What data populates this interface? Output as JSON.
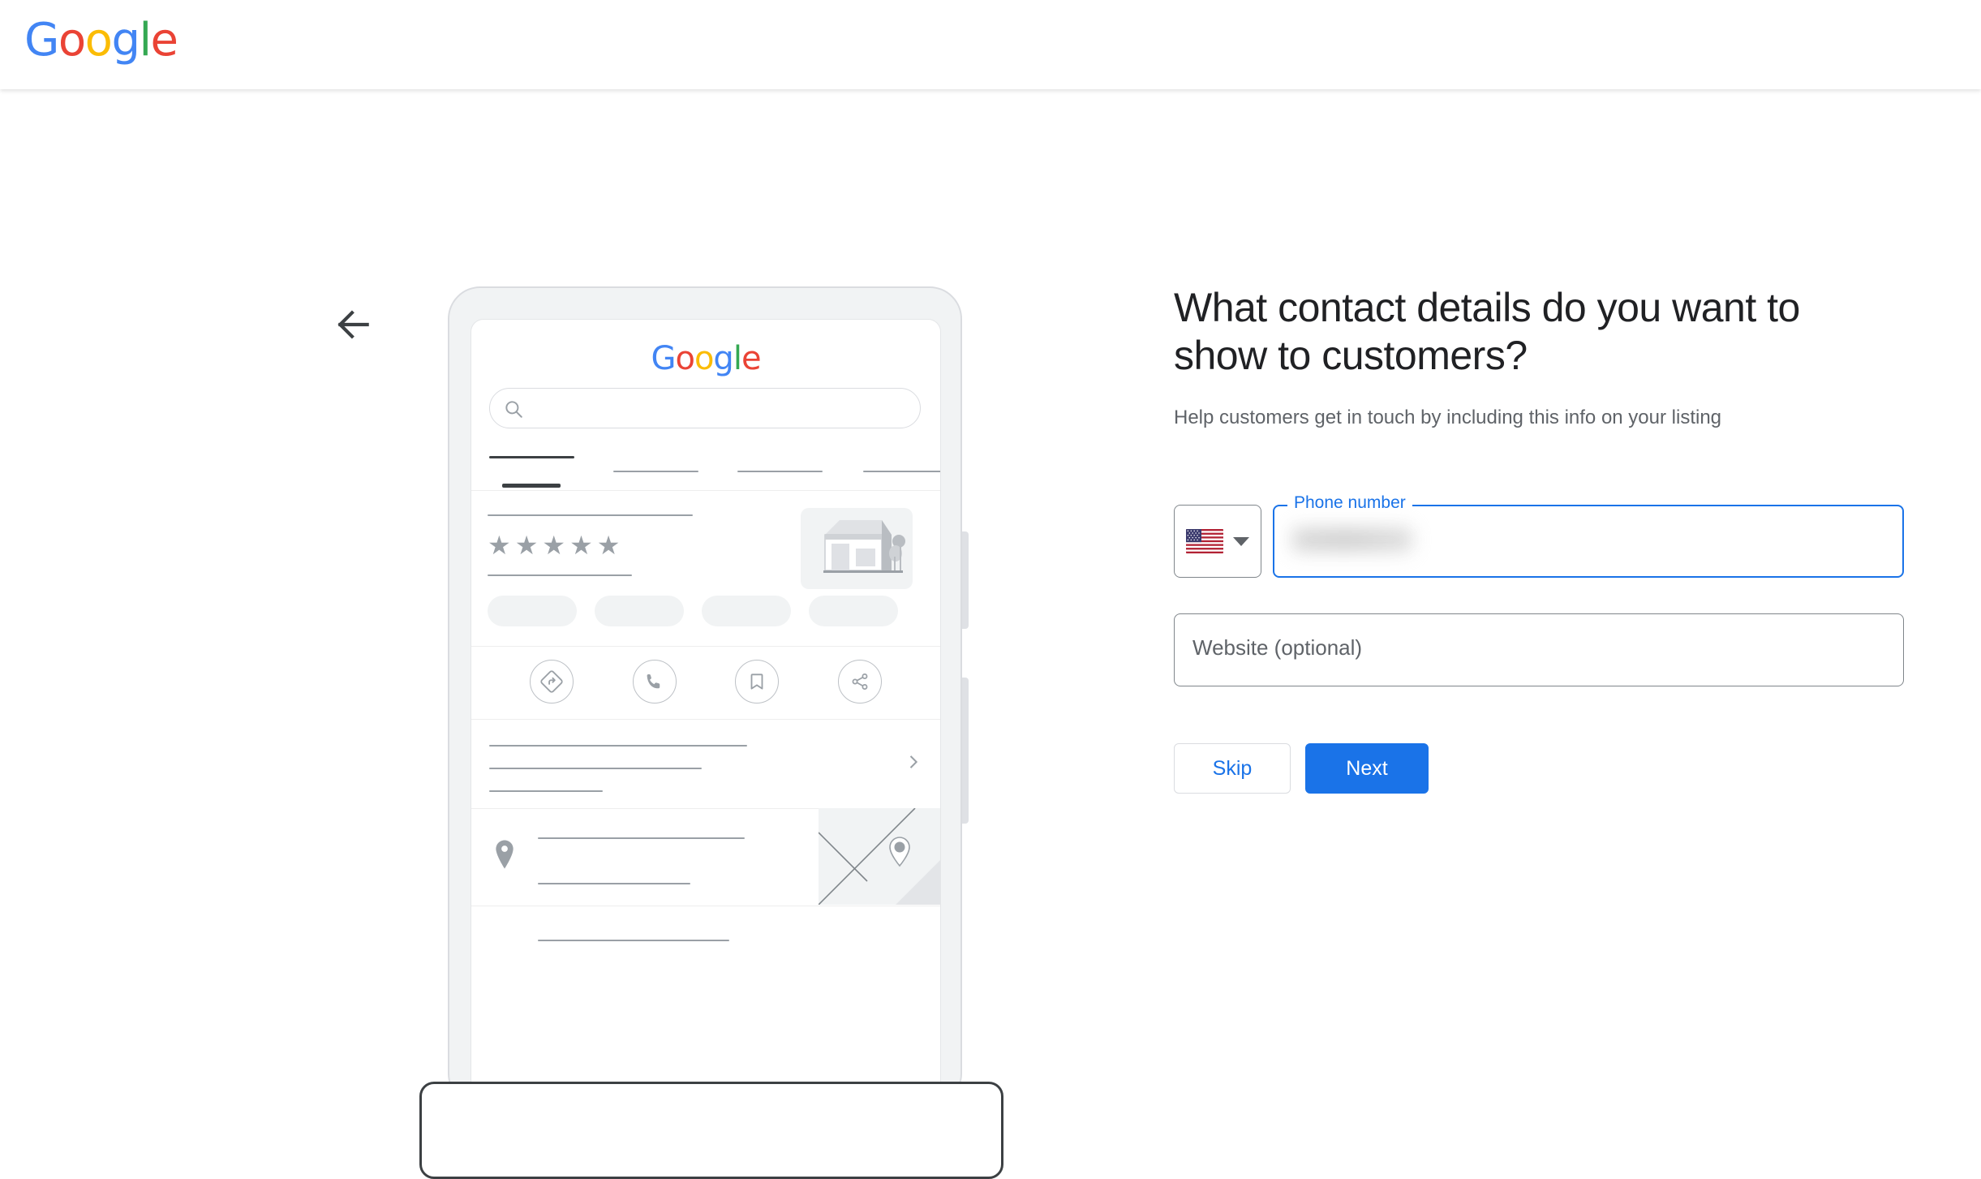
{
  "header": {
    "logo_letters": [
      {
        "char": "G",
        "color": "#4285F4"
      },
      {
        "char": "o",
        "color": "#EA4335"
      },
      {
        "char": "o",
        "color": "#FBBC05"
      },
      {
        "char": "g",
        "color": "#4285F4"
      },
      {
        "char": "l",
        "color": "#34A853"
      },
      {
        "char": "e",
        "color": "#EA4335"
      }
    ],
    "logo_text": "Google"
  },
  "nav": {
    "back_label": "Back",
    "back_icon": "arrow-left-icon"
  },
  "illustration": {
    "device": "phone-mockup",
    "mini_logo_text": "Google",
    "search_icon": "search-icon",
    "star_glyphs": "★★★★★",
    "star_count": 5,
    "tabs_count": 4,
    "chips_count": 4,
    "actions": [
      {
        "name": "directions-icon",
        "label": "Directions"
      },
      {
        "name": "call-icon",
        "label": "Call"
      },
      {
        "name": "save-icon",
        "label": "Save"
      },
      {
        "name": "share-icon",
        "label": "Share"
      }
    ],
    "chevron_icon": "chevron-right-icon",
    "pin_icon": "location-pin-icon",
    "map_pin_icon": "map-pin-icon",
    "store_icon": "storefront-icon"
  },
  "form": {
    "title": "What contact details do you want to show to customers?",
    "subtitle": "Help customers get in touch by including this info on your listing",
    "phone": {
      "label": "Phone number",
      "value": "",
      "value_state": "redacted",
      "country_flag": "us-flag-icon",
      "country_code": "US",
      "dropdown_icon": "chevron-down-icon",
      "focused": true
    },
    "website": {
      "placeholder": "Website (optional)",
      "value": ""
    },
    "buttons": {
      "skip": "Skip",
      "next": "Next"
    }
  },
  "colors": {
    "accent_blue": "#1a73e8",
    "text_primary": "#202124",
    "text_secondary": "#5f6368",
    "border_gray": "#80868b",
    "placeholder_gray": "#f1f3f4",
    "google_blue": "#4285F4",
    "google_red": "#EA4335",
    "google_yellow": "#FBBC05",
    "google_green": "#34A853"
  }
}
